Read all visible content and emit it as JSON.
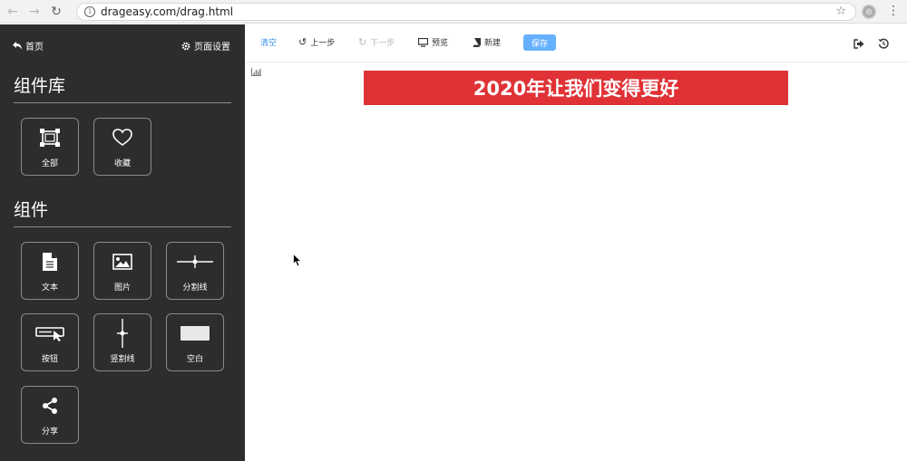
{
  "browser": {
    "url": "drageasy.com/drag.html",
    "info_glyph": "i"
  },
  "sidebar": {
    "home_label": "首页",
    "settings_label": "页面设置",
    "library_title": "组件库",
    "library_items": [
      {
        "label": "全部",
        "icon": "frame-icon"
      },
      {
        "label": "收藏",
        "icon": "heart-icon"
      }
    ],
    "components_title": "组件",
    "components": [
      {
        "label": "文本",
        "icon": "document-icon"
      },
      {
        "label": "图片",
        "icon": "image-icon"
      },
      {
        "label": "分割线",
        "icon": "horizontal-divider-icon"
      },
      {
        "label": "按钮",
        "icon": "button-icon"
      },
      {
        "label": "竖割线",
        "icon": "vertical-divider-icon"
      },
      {
        "label": "空白",
        "icon": "blank-icon"
      },
      {
        "label": "分享",
        "icon": "share-icon"
      }
    ]
  },
  "toolbar": {
    "clear_label": "清空",
    "undo_label": "上一步",
    "redo_label": "下一步",
    "preview_label": "预览",
    "new_label": "新建",
    "save_label": "保存"
  },
  "canvas": {
    "banner_text": "2020年让我们变得更好"
  },
  "colors": {
    "sidebar_bg": "#2d2d2d",
    "banner_bg": "#e03236",
    "accent": "#3a8ee6",
    "save_bg": "#66b1ff"
  }
}
